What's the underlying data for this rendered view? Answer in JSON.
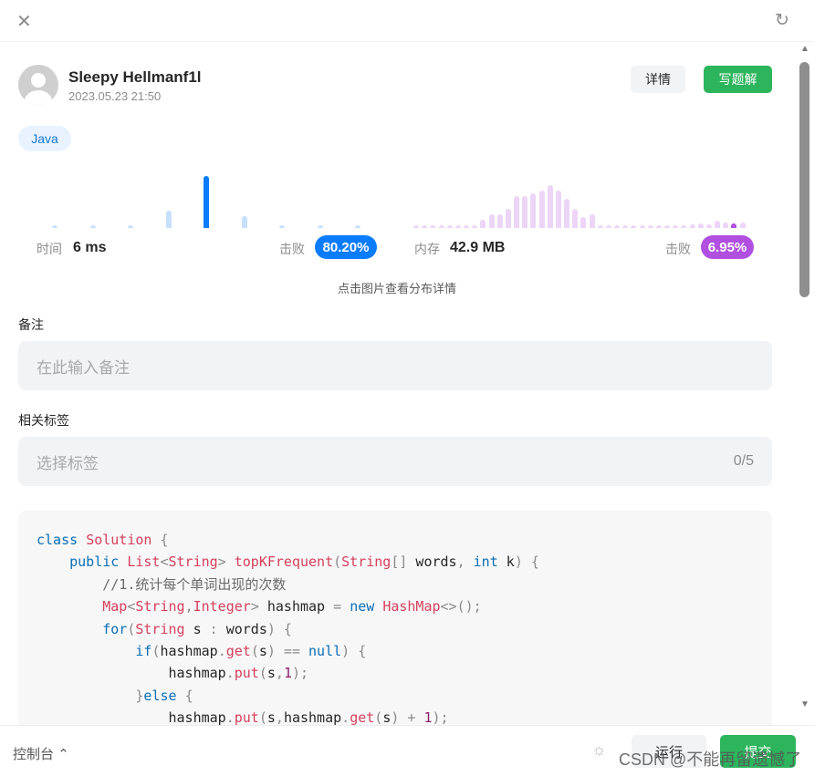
{
  "user": {
    "name": "Sleepy Hellmanf1l",
    "date": "2023.05.23 21:50"
  },
  "buttons": {
    "details": "详情",
    "write_solution": "写题解",
    "run": "运行",
    "submit": "提交"
  },
  "language": "Java",
  "runtime": {
    "label": "时间",
    "value": "6 ms",
    "beat_label": "击败",
    "beat": "80.20%",
    "color": "#0a7cff",
    "chart_data": {
      "type": "bar",
      "values": [
        1,
        1,
        1,
        6,
        18,
        4,
        1,
        1,
        1
      ],
      "highlight_index": 4
    }
  },
  "memory": {
    "label": "内存",
    "value": "42.9 MB",
    "beat_label": "击败",
    "beat": "6.95%",
    "color": "#b04fe0",
    "chart_data": {
      "type": "bar",
      "values": [
        1,
        1,
        1,
        1,
        1,
        1,
        1,
        1,
        3,
        5,
        5,
        7,
        12,
        12,
        13,
        14,
        16,
        14,
        11,
        7,
        4,
        5,
        1,
        1,
        1,
        1,
        1,
        1,
        1,
        1,
        1,
        1,
        1,
        1.3,
        1.7,
        1.3,
        2.7,
        2,
        1.7,
        2
      ],
      "highlight_index": 38
    }
  },
  "hint": "点击图片查看分布详情",
  "note": {
    "label": "备注",
    "placeholder": "在此输入备注"
  },
  "tags": {
    "label": "相关标签",
    "placeholder": "选择标签",
    "count": "0/5"
  },
  "console": "控制台",
  "watermark": "CSDN @不能再留遗憾了",
  "icons": {
    "close": "close-icon",
    "refresh": "refresh-icon",
    "bug": "bug-icon",
    "chevron": "chevron-up-icon"
  }
}
